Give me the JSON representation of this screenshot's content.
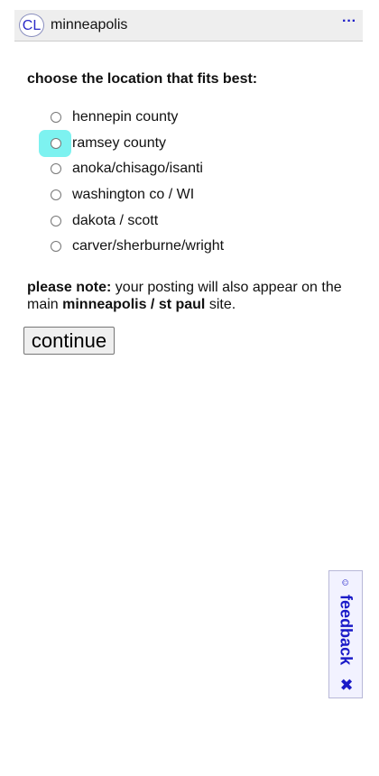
{
  "header": {
    "logo": "CL",
    "site": "minneapolis",
    "menu_icon": "···"
  },
  "form": {
    "heading": "choose the location that fits best:",
    "selected_highlight_index": 1,
    "options": [
      {
        "label": "hennepin county"
      },
      {
        "label": "ramsey county"
      },
      {
        "label": "anoka/chisago/isanti"
      },
      {
        "label": "washington co / WI"
      },
      {
        "label": "dakota / scott"
      },
      {
        "label": "carver/sherburne/wright"
      }
    ]
  },
  "note": {
    "prefix": "please note:",
    "text": " your posting will also appear on the main ",
    "site": "minneapolis / st paul",
    "suffix": " site."
  },
  "buttons": {
    "continue": "continue"
  },
  "feedback": {
    "label": "feedback",
    "smile_icon": "☺",
    "close_icon": "✖"
  },
  "colors": {
    "highlight": "#7df2f0",
    "link_blue": "#1a1ac8"
  }
}
